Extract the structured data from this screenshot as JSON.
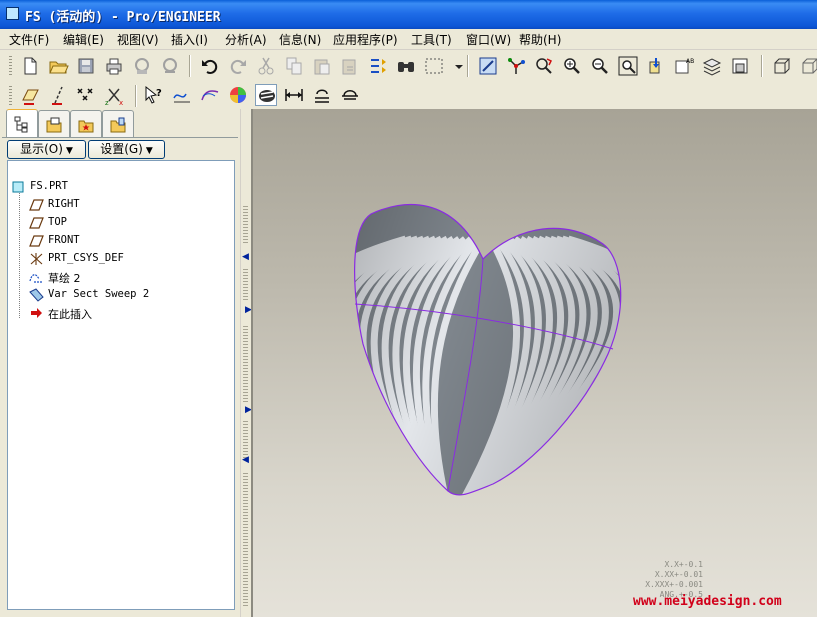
{
  "window": {
    "title": "FS (活动的) - Pro/ENGINEER"
  },
  "menu": [
    {
      "label": "文件(F)"
    },
    {
      "label": "编辑(E)"
    },
    {
      "label": "视图(V)"
    },
    {
      "label": "插入(I)"
    },
    {
      "label": "分析(A)"
    },
    {
      "label": "信息(N)"
    },
    {
      "label": "应用程序(P)"
    },
    {
      "label": "工具(T)"
    },
    {
      "label": "窗口(W)"
    },
    {
      "label": "帮助(H)"
    }
  ],
  "toolbar_main": {
    "icons": [
      "new-icon",
      "open-icon",
      "save-icon",
      "print-icon",
      "send-icon",
      "send-all-icon",
      "undo-icon",
      "redo-icon",
      "cut-icon",
      "copy-icon",
      "paste-icon",
      "paste-special-icon",
      "regenerate-icon",
      "find-icon",
      "select-box-icon",
      "repaint-icon",
      "spin-center-icon",
      "orient-icon",
      "zoom-in-icon",
      "zoom-out-icon",
      "refit-icon",
      "reorient-icon",
      "named-view-icon",
      "layers-icon",
      "view-manager-icon",
      "wireframe-icon",
      "hidden-line-icon"
    ]
  },
  "toolbar_datum": {
    "icons": [
      "datum-plane-icon",
      "datum-axis-icon",
      "datum-point-icon",
      "datum-csys-icon",
      "whats-this-icon",
      "sketch-icon",
      "curve-icon",
      "appearance-icon",
      "zebra-icon",
      "measure-icon",
      "section-icon",
      "slope-icon"
    ]
  },
  "nav": {
    "tabs": [
      "model-tree-tab",
      "folder-browser-tab",
      "favorites-tab",
      "connections-tab"
    ],
    "show_button": "显示(O)",
    "settings_button": "设置(G)"
  },
  "tree": {
    "root": "FS.PRT",
    "items": [
      {
        "label": "RIGHT",
        "icon": "datum-plane-icon"
      },
      {
        "label": "TOP",
        "icon": "datum-plane-icon"
      },
      {
        "label": "FRONT",
        "icon": "datum-plane-icon"
      },
      {
        "label": "PRT_CSYS_DEF",
        "icon": "csys-icon"
      },
      {
        "label": "草绘 2",
        "icon": "sketch-icon"
      },
      {
        "label": "Var Sect Sweep 2",
        "icon": "sweep-icon"
      },
      {
        "label": "在此插入",
        "icon": "insert-here-arrow-icon"
      }
    ]
  },
  "viewport": {
    "tolerances": [
      "X.X+-0.1",
      "X.XX+-0.01",
      "X.XXX+-0.001",
      "ANG.+-0.5"
    ],
    "watermark": "www.meiyadesign.com"
  },
  "colors": {
    "title_bar": "#0a5fd8",
    "model_edge": "#8a2be2",
    "zebra_light": "#e3e6ea",
    "zebra_dark": "#7f868d",
    "watermark": "#d1001a"
  }
}
